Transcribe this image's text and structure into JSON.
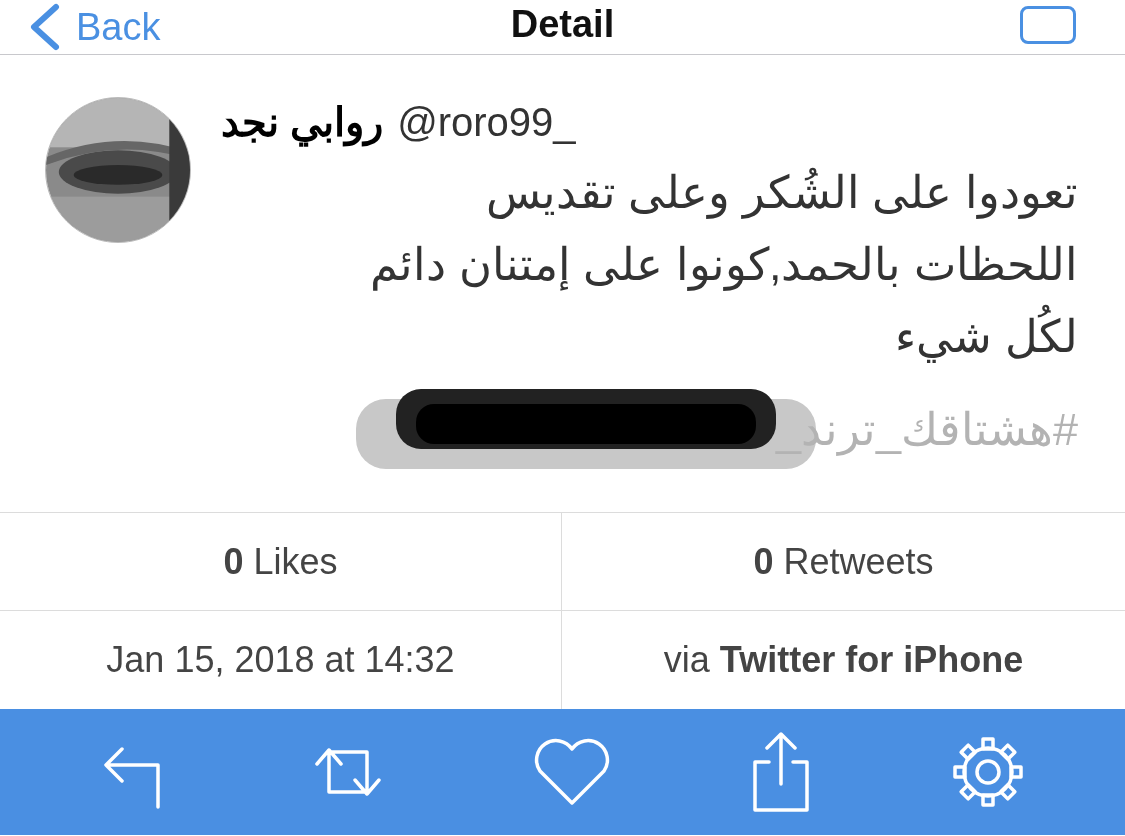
{
  "nav": {
    "back": "Back",
    "title": "Detail"
  },
  "tweet": {
    "name": "روابي نجد",
    "handle": "@roro99_",
    "text": "تعودوا على الشُكر وعلى تقديس اللحظات بالحمد,كونوا على إمتنان دائم لكُل شيء",
    "hashtag": "#هشتاقك_ترند_"
  },
  "stats": {
    "likes": "**0** Likes",
    "retweets": "**0** Retweets",
    "date": "Jan 15, 2018 at 14:32",
    "source": "via **Twitter for iPhone**"
  }
}
